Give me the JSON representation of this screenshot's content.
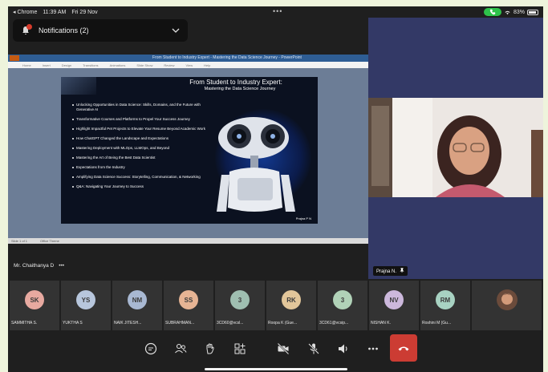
{
  "status_bar": {
    "back": "◂ Chrome",
    "time": "11:39 AM",
    "date": "Fri 29 Nov",
    "dots": "•••",
    "battery": "83%"
  },
  "notifications": {
    "label": "Notifications (2)"
  },
  "ppt": {
    "file_title": "From Student to Industry Expert - Mastering the Data Science Journey - PowerPoint",
    "menu": [
      "Home",
      "Insert",
      "Design",
      "Transitions",
      "Animations",
      "Slide Show",
      "Review",
      "View",
      "Help"
    ],
    "status_left": "Slide 1 of 1",
    "status_right": "Office Theme"
  },
  "slide": {
    "title": "From Student to Industry Expert:",
    "subtitle": "Mastering the Data Science Journey",
    "bullets": [
      "Unlocking Opportunities in Data Science: Skills, Domains, and the Future with Generative AI",
      "Transformative Courses and Platforms to Propel Your Success Journey",
      "Highlight Impactful Pet Projects to Elevate Your Resume Beyond Academic Work",
      "How ChatGPT Changed the Landscape and Expectations",
      "Mastering Deployment with MLOps, LLMOps, and Beyond",
      "Mastering the Art of Being the Best Data Scientist",
      "Expectations from the Industry",
      "Amplifying Data Science Success: Storytelling, Communication, & Networking",
      "Q&A: Navigating Your Journey to Success"
    ],
    "logo": "Prajna P N"
  },
  "host": {
    "name": "Mr. Chaithanya D",
    "more": "•••"
  },
  "speaker": {
    "name": "Prajna N."
  },
  "participants": [
    {
      "initials": "SK",
      "name": "SAMMITHA S.",
      "color": "#e7a9a0"
    },
    {
      "initials": "YS",
      "name": "YUKTHA S",
      "color": "#b7c6dc"
    },
    {
      "initials": "NM",
      "name": "NAIK JITESH...",
      "color": "#a8b8d2"
    },
    {
      "initials": "SS",
      "name": "SUBRAHMAN...",
      "color": "#e6b494"
    },
    {
      "initials": "3",
      "name": "3CD60@vcsl...",
      "color": "#9fbfb1"
    },
    {
      "initials": "RK",
      "name": "Roopa K (Gue...",
      "color": "#e2c69a"
    },
    {
      "initials": "3",
      "name": "3CD61@vcsip...",
      "color": "#b1d2b8"
    },
    {
      "initials": "NV",
      "name": "NISHAN K.",
      "color": "#ccb8dc"
    },
    {
      "initials": "RM",
      "name": "Roshini M (Gu...",
      "color": "#a8d2c2"
    }
  ],
  "controls": [
    "chat-icon",
    "participants-icon",
    "raise-hand-icon",
    "apps-icon",
    "camera-off-icon",
    "mic-off-icon",
    "speaker-icon",
    "more-icon",
    "hang-up-icon"
  ]
}
